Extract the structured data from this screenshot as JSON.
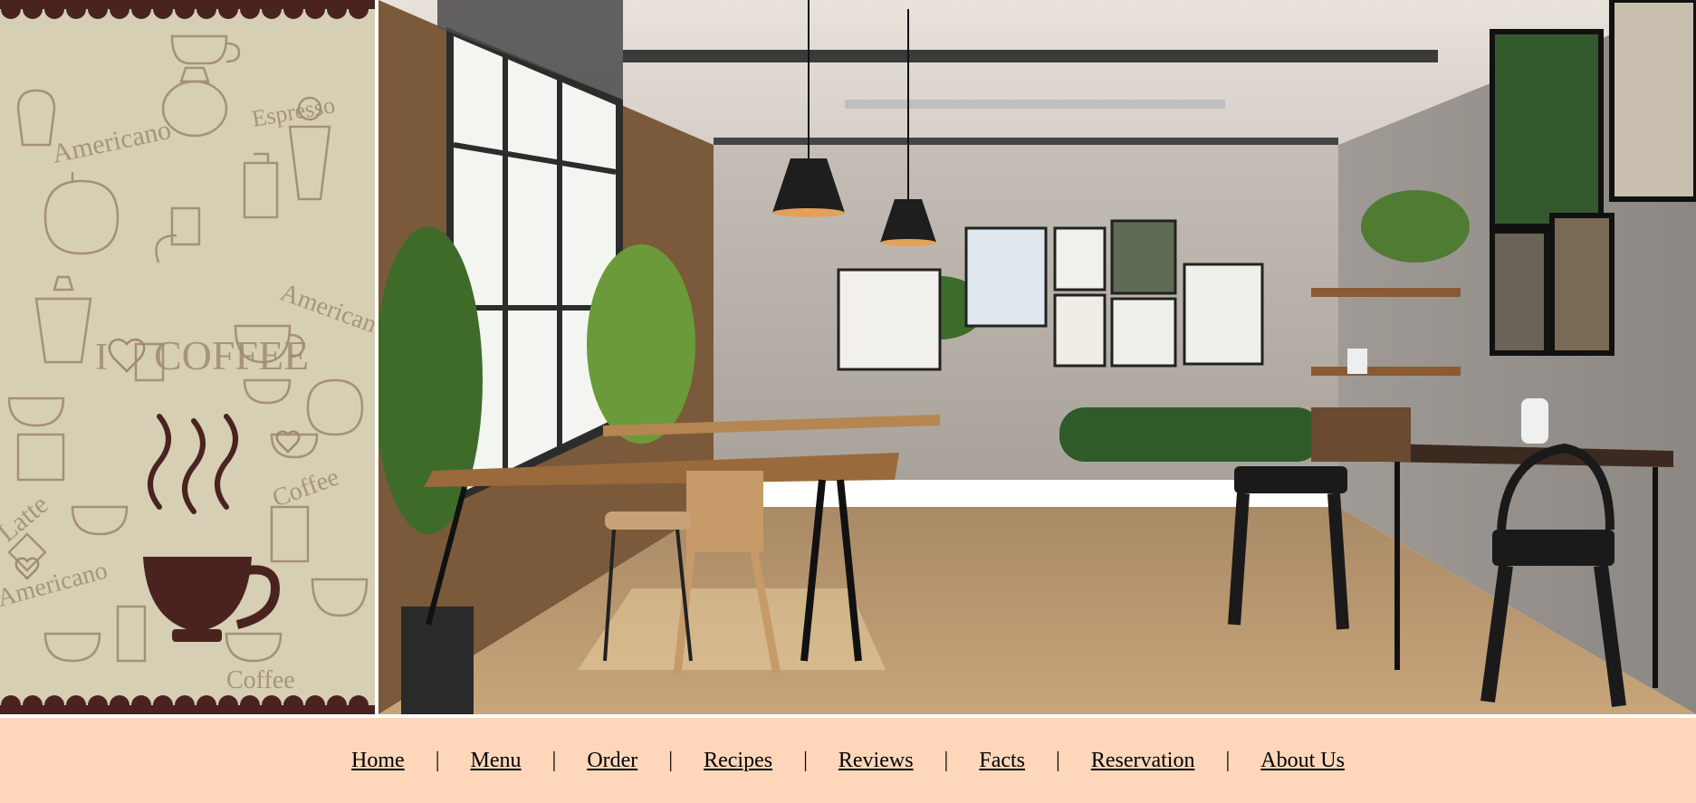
{
  "hero": {
    "left_panel": {
      "doodle_words": [
        "Americano",
        "Espresso",
        "I",
        "COFFEE",
        "Americano",
        "Latte",
        "Coffee",
        "Americano",
        "Coffee"
      ],
      "colors": {
        "background": "#d6cfb4",
        "doodle": "#a18a6d",
        "cup": "#4a2320",
        "scallop": "#4a2320"
      },
      "icons": [
        "coffee-cup-icon",
        "heart-icon",
        "coffee-pattern"
      ]
    },
    "photo": {
      "icons": [
        "pendant-lamp",
        "window",
        "plant",
        "table",
        "chair",
        "framed-art"
      ]
    }
  },
  "nav": {
    "background": "#fed7ba",
    "separator": "|",
    "items": [
      {
        "label": "Home"
      },
      {
        "label": "Menu"
      },
      {
        "label": "Order"
      },
      {
        "label": "Recipes"
      },
      {
        "label": "Reviews"
      },
      {
        "label": "Facts"
      },
      {
        "label": "Reservation"
      },
      {
        "label": "About Us"
      }
    ]
  }
}
